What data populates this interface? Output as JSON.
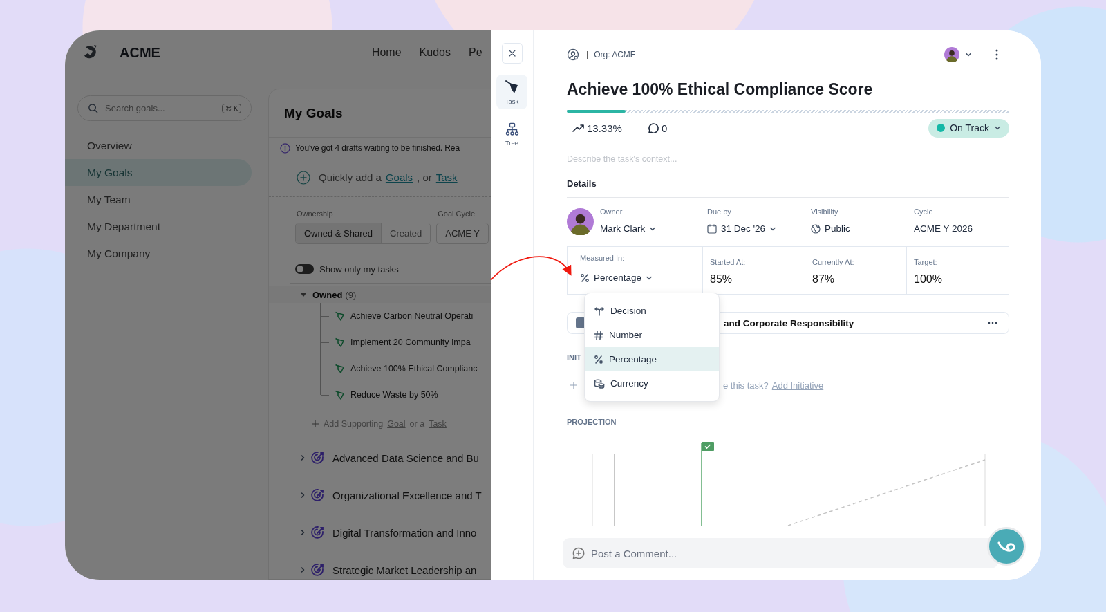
{
  "left_app": {
    "brand": "ACME",
    "nav": [
      {
        "label": "Home"
      },
      {
        "label": "Kudos"
      },
      {
        "label": "Pe"
      }
    ],
    "search": {
      "placeholder": "Search goals...",
      "shortcut": "⌘ K"
    },
    "sidebar": {
      "items": [
        {
          "label": "Overview",
          "selected": false
        },
        {
          "label": "My Goals",
          "selected": true
        },
        {
          "label": "My Team",
          "selected": false
        },
        {
          "label": "My Department",
          "selected": false
        },
        {
          "label": "My Company",
          "selected": false
        }
      ]
    },
    "goals_page": {
      "title": "My Goals",
      "drafts_notice": "You've got 4 drafts waiting to be finished. Rea",
      "quick_add": {
        "text": "Quickly add a",
        "goal_link": "Goals",
        "separator": ", or",
        "task_link": "Task"
      },
      "ownership_label": "Ownership",
      "ownership_options": [
        {
          "label": "Owned & Shared",
          "selected": true
        },
        {
          "label": "Created",
          "selected": false
        }
      ],
      "cycle_label": "Goal Cycle",
      "cycle_value": "ACME Y",
      "toggle": {
        "label": "Show only my tasks",
        "on": false
      },
      "group": {
        "label": "Owned",
        "count": "(9)",
        "expanded": true,
        "tasks": [
          {
            "title": "Achieve Carbon Neutral Operati"
          },
          {
            "title": "Implement 20 Community Impa"
          },
          {
            "title": "Achieve 100% Ethical Complianc"
          },
          {
            "title": "Reduce Waste by 50%"
          }
        ],
        "add_supporting": {
          "text": "Add Supporting",
          "goal_link": "Goal",
          "separator": "or a",
          "task_link": "Task"
        }
      },
      "goals": [
        {
          "title": "Advanced Data Science and Bu",
          "expanded": false
        },
        {
          "title": "Organizational Excellence and T",
          "expanded": false
        },
        {
          "title": "Digital Transformation and Inno",
          "expanded": false
        },
        {
          "title": "Strategic Market Leadership an",
          "expanded": false
        }
      ]
    }
  },
  "task_panel": {
    "rail": [
      {
        "label": "Task",
        "kind": "task",
        "selected": true
      },
      {
        "label": "Tree",
        "kind": "tree",
        "selected": false
      }
    ],
    "separator": "|",
    "org": "Org: ACME",
    "title": "Achieve 100% Ethical Compliance Score",
    "progress": {
      "level": 0.133
    },
    "growth": "13.33%",
    "comments": "0",
    "status": "On Track",
    "description": {
      "placeholder": "Describe the task's context..."
    },
    "details_heading": "Details",
    "fields": [
      {
        "label": "Owner",
        "value": "Mark Clark",
        "kind": "person"
      },
      {
        "label": "Due by",
        "value": "31 Dec '26",
        "kind": "date"
      },
      {
        "label": "Visibility",
        "value": "Public",
        "kind": "visibility"
      },
      {
        "label": "Cycle",
        "value": "ACME Y 2026",
        "kind": "text"
      }
    ],
    "measure": {
      "label": "Measured In:",
      "value": "Percentage",
      "kind": "percentage",
      "expanded": true,
      "options": [
        {
          "label": "Decision",
          "kind": "decision",
          "selected": false
        },
        {
          "label": "Number",
          "kind": "number",
          "selected": false
        },
        {
          "label": "Percentage",
          "kind": "percentage",
          "selected": true
        },
        {
          "label": "Currency",
          "kind": "currency",
          "selected": false
        }
      ]
    },
    "metrics": [
      {
        "label": "Started At:",
        "value": "85%"
      },
      {
        "label": "Currently At:",
        "value": "87%"
      },
      {
        "label": "Target:",
        "value": "100%"
      }
    ],
    "parent_goal": {
      "title": "and Corporate Responsibility"
    },
    "initiatives": {
      "heading": "INIT",
      "prompt": "e this task?",
      "link": "Add Initiative"
    },
    "projection": {
      "heading": "PROJECTION"
    },
    "comment": {
      "placeholder": "Post a Comment..."
    }
  }
}
